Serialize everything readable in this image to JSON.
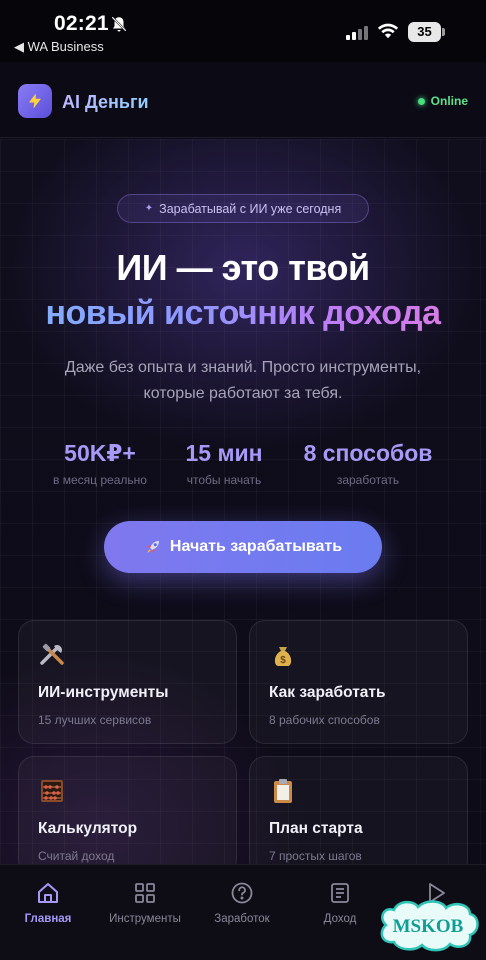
{
  "statusbar": {
    "time": "02:21",
    "back_app": "◀ WA Business",
    "battery": "35"
  },
  "header": {
    "app_title": "AI Деньги",
    "status": "Online"
  },
  "hero": {
    "pill": "Зарабатывай с ИИ уже сегодня",
    "title_line1": "ИИ — это твой",
    "title_line2": "новый источник дохода",
    "subtitle": "Даже без опыта и знаний. Просто инструменты, которые работают за тебя.",
    "stats": [
      {
        "value": "50K₽+",
        "label": "в месяц реально"
      },
      {
        "value": "15 мин",
        "label": "чтобы начать"
      },
      {
        "value": "8 способов",
        "label": "заработать"
      }
    ],
    "cta": "Начать зарабатывать"
  },
  "cards": [
    {
      "title": "ИИ-инструменты",
      "subtitle": "15 лучших сервисов",
      "icon": "tools-icon"
    },
    {
      "title": "Как заработать",
      "subtitle": "8 рабочих способов",
      "icon": "money-bag-icon"
    },
    {
      "title": "Калькулятор",
      "subtitle": "Считай доход",
      "icon": "abacus-icon"
    },
    {
      "title": "План старта",
      "subtitle": "7 простых шагов",
      "icon": "clipboard-icon"
    }
  ],
  "nav": [
    {
      "label": "Главная",
      "icon": "home-icon",
      "active": true
    },
    {
      "label": "Инструменты",
      "icon": "grid-icon",
      "active": false
    },
    {
      "label": "Заработок",
      "icon": "question-icon",
      "active": false
    },
    {
      "label": "Доход",
      "icon": "document-icon",
      "active": false
    },
    {
      "label": "",
      "icon": "play-icon",
      "active": false
    }
  ],
  "watermark": {
    "text": "MSKOB"
  },
  "colors": {
    "accent": "#a799f7",
    "online": "#4ade80",
    "background": "#0b0a14"
  }
}
